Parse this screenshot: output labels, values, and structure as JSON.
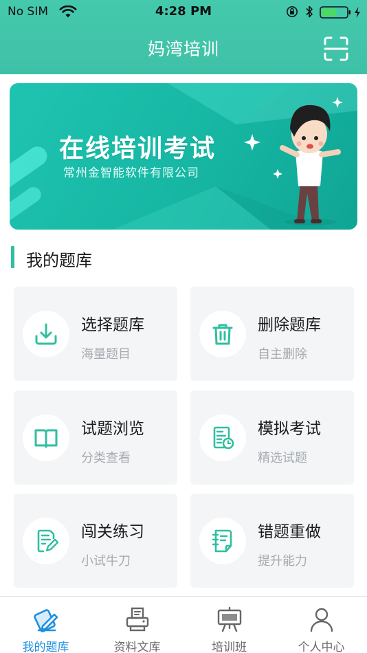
{
  "status_bar": {
    "carrier": "No SIM",
    "time": "4:28 PM",
    "battery_level": 0.6
  },
  "nav": {
    "title": "妈湾培训",
    "scan_icon": "scan-icon"
  },
  "banner": {
    "title": "在线培训考试",
    "subtitle": "常州金智能软件有限公司"
  },
  "section": {
    "title": "我的题库"
  },
  "cards": [
    {
      "title": "选择题库",
      "subtitle": "海量题目",
      "icon": "download-icon"
    },
    {
      "title": "删除题库",
      "subtitle": "自主删除",
      "icon": "trash-icon"
    },
    {
      "title": "试题浏览",
      "subtitle": "分类查看",
      "icon": "book-icon"
    },
    {
      "title": "模拟考试",
      "subtitle": "精选试题",
      "icon": "exam-paper-icon"
    },
    {
      "title": "闯关练习",
      "subtitle": "小试牛刀",
      "icon": "edit-document-icon"
    },
    {
      "title": "错题重做",
      "subtitle": "提升能力",
      "icon": "notebook-icon"
    }
  ],
  "tabs": [
    {
      "label": "我的题库",
      "icon": "question-bank-icon",
      "active": true
    },
    {
      "label": "资料文库",
      "icon": "printer-icon",
      "active": false
    },
    {
      "label": "培训班",
      "icon": "presentation-board-icon",
      "active": false
    },
    {
      "label": "个人中心",
      "icon": "person-icon",
      "active": false
    }
  ],
  "colors": {
    "brand": "#3ec1a6",
    "icon_accent": "#2fbf9f",
    "tab_active": "#1d8fe0",
    "tab_inactive": "#6a6a6a",
    "card_bg": "#f3f5f7",
    "subtext": "#a7abb0"
  }
}
